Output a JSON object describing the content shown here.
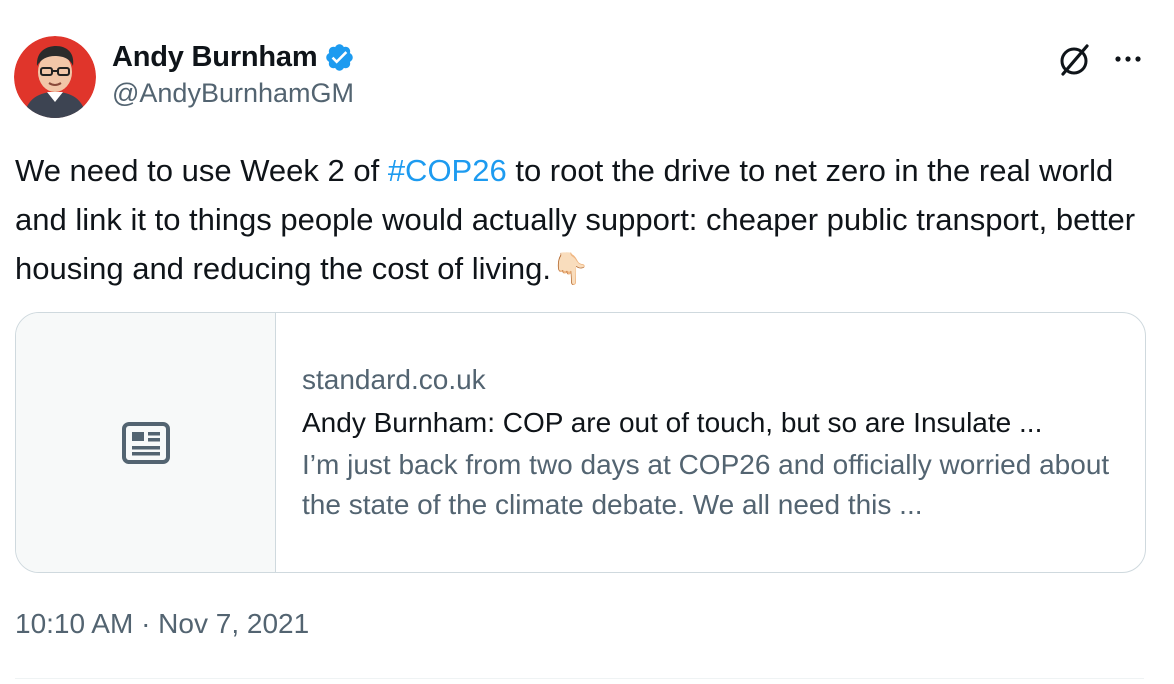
{
  "author": {
    "name": "Andy Burnham",
    "handle": "@AndyBurnhamGM",
    "verified": true,
    "avatar_icon": "person-avatar-icon"
  },
  "header_actions": {
    "grok_icon": "grok-icon",
    "more_icon": "more-icon"
  },
  "tweet": {
    "text_before_hashtag": "We need to use Week 2 of ",
    "hashtag": "#COP26",
    "text_after_hashtag": " to root the drive to net zero in the real world and link it to things people would actually support: cheaper public transport, better housing and reducing the cost of living.",
    "emoji": "👇🏻"
  },
  "link_card": {
    "thumb_icon": "article-icon",
    "domain": "standard.co.uk",
    "title": "Andy Burnham: COP are out of touch, but so are Insulate ...",
    "description": "I’m just back from two days at COP26 and officially worried about the state of the climate debate. We all need this ..."
  },
  "timestamp": "10:10 AM · Nov 7, 2021",
  "colors": {
    "link": "#1d9bf0",
    "secondary_text": "#536471",
    "primary_text": "#0f1419",
    "border": "#cfd9de",
    "avatar_bg": "#e0352b"
  }
}
